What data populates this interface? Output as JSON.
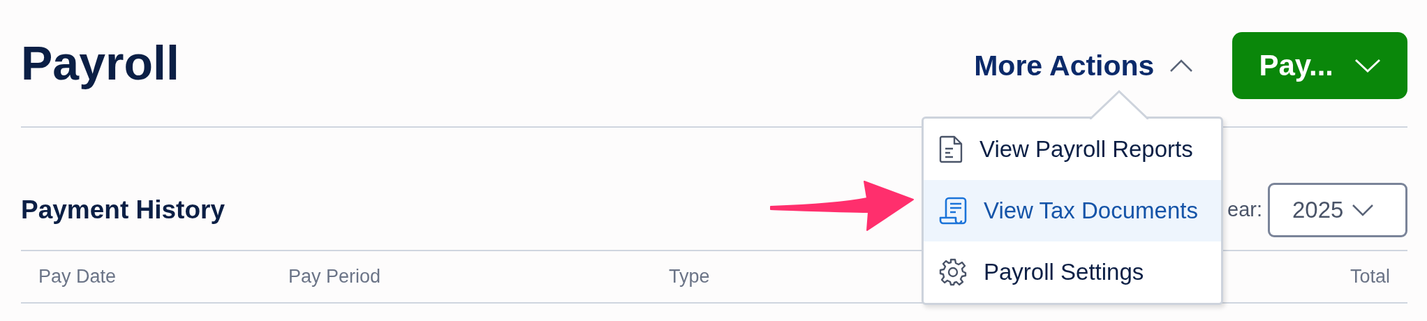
{
  "page": {
    "title": "Payroll"
  },
  "header_actions": {
    "more_actions": {
      "label": "More Actions",
      "expanded": true
    },
    "pay_button": {
      "label": "Pay..."
    }
  },
  "menu": {
    "items": [
      {
        "label": "View Payroll Reports",
        "kind": "document",
        "selected": false
      },
      {
        "label": "View Tax Documents",
        "kind": "receipt",
        "selected": true
      },
      {
        "label": "Payroll Settings",
        "kind": "gear",
        "selected": false
      }
    ]
  },
  "section": {
    "title": "Payment History",
    "year_label": "ear:",
    "year_select": {
      "value": "2025"
    }
  },
  "table": {
    "columns": [
      "Pay Date",
      "Pay Period",
      "Type",
      "Total"
    ]
  }
}
